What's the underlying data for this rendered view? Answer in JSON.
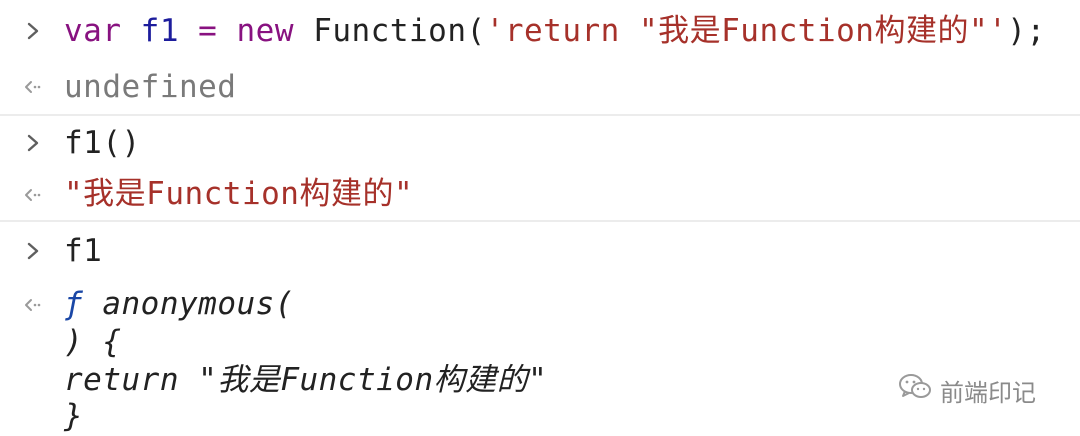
{
  "console": {
    "entries": [
      {
        "type": "input",
        "parts": {
          "kw1": "var",
          "ident": "f1",
          "op": "=",
          "kw2": "new",
          "ctor": "Function(",
          "str": "'return \"我是Function构建的\"'",
          "end": ");"
        }
      },
      {
        "type": "output",
        "text": "undefined"
      },
      {
        "type": "input",
        "text": "f1()"
      },
      {
        "type": "output",
        "text": "\"我是Function构建的\""
      },
      {
        "type": "input",
        "text": "f1"
      },
      {
        "type": "output",
        "lines": {
          "l1_fn": "ƒ",
          "l1_rest": "anonymous(",
          "l2": ") {",
          "l3_kw": "return",
          "l3_str": "\"我是Function构建的\"",
          "l4": "}"
        }
      }
    ]
  },
  "watermark": {
    "text": "前端印记",
    "icon": "wechat-icon"
  },
  "colors": {
    "keyword": "#881280",
    "string": "#a6312a",
    "identifier": "#1c1c9c",
    "function_glyph": "#1a47a6",
    "muted": "#7a7a7a",
    "divider": "#ececec"
  }
}
